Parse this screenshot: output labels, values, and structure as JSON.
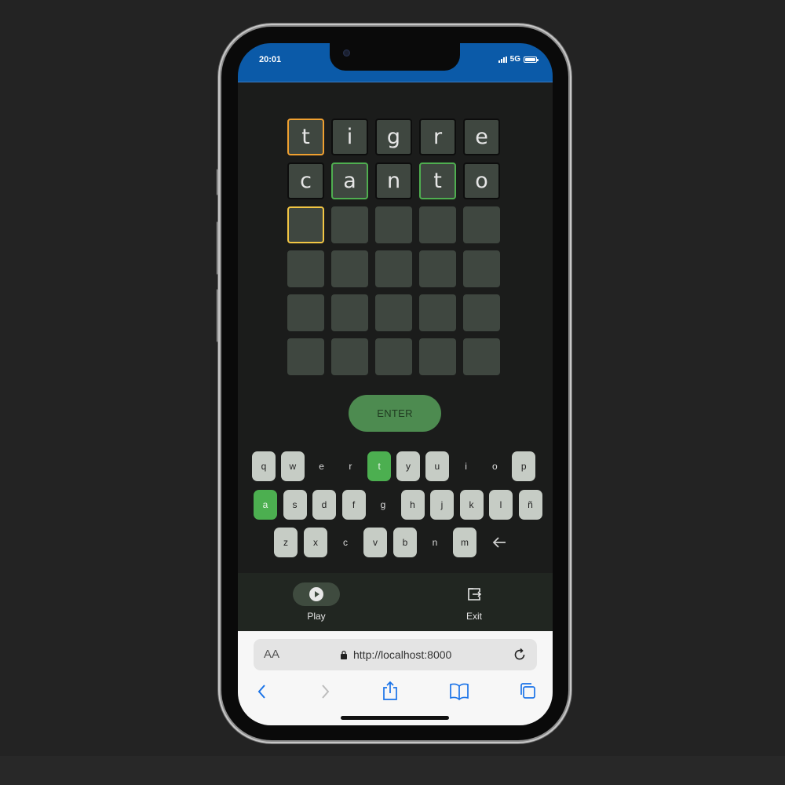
{
  "status": {
    "time": "20:01",
    "network": "5G"
  },
  "board": {
    "rows": [
      [
        {
          "letter": "t",
          "state": "present"
        },
        {
          "letter": "i",
          "state": "filled"
        },
        {
          "letter": "g",
          "state": "filled"
        },
        {
          "letter": "r",
          "state": "filled"
        },
        {
          "letter": "e",
          "state": "filled"
        }
      ],
      [
        {
          "letter": "c",
          "state": "filled"
        },
        {
          "letter": "a",
          "state": "correct"
        },
        {
          "letter": "n",
          "state": "filled"
        },
        {
          "letter": "t",
          "state": "correct"
        },
        {
          "letter": "o",
          "state": "filled"
        }
      ],
      [
        {
          "letter": "",
          "state": "cursor"
        },
        {
          "letter": "",
          "state": "empty"
        },
        {
          "letter": "",
          "state": "empty"
        },
        {
          "letter": "",
          "state": "empty"
        },
        {
          "letter": "",
          "state": "empty"
        }
      ],
      [
        {
          "letter": "",
          "state": "empty"
        },
        {
          "letter": "",
          "state": "empty"
        },
        {
          "letter": "",
          "state": "empty"
        },
        {
          "letter": "",
          "state": "empty"
        },
        {
          "letter": "",
          "state": "empty"
        }
      ],
      [
        {
          "letter": "",
          "state": "empty"
        },
        {
          "letter": "",
          "state": "empty"
        },
        {
          "letter": "",
          "state": "empty"
        },
        {
          "letter": "",
          "state": "empty"
        },
        {
          "letter": "",
          "state": "empty"
        }
      ],
      [
        {
          "letter": "",
          "state": "empty"
        },
        {
          "letter": "",
          "state": "empty"
        },
        {
          "letter": "",
          "state": "empty"
        },
        {
          "letter": "",
          "state": "empty"
        },
        {
          "letter": "",
          "state": "empty"
        }
      ]
    ],
    "enter_label": "ENTER"
  },
  "keyboard": {
    "rows": [
      [
        {
          "key": "q",
          "state": "normal"
        },
        {
          "key": "w",
          "state": "normal"
        },
        {
          "key": "e",
          "state": "used"
        },
        {
          "key": "r",
          "state": "used"
        },
        {
          "key": "t",
          "state": "hit"
        },
        {
          "key": "y",
          "state": "normal"
        },
        {
          "key": "u",
          "state": "normal"
        },
        {
          "key": "i",
          "state": "used"
        },
        {
          "key": "o",
          "state": "used"
        },
        {
          "key": "p",
          "state": "normal"
        }
      ],
      [
        {
          "key": "a",
          "state": "hit"
        },
        {
          "key": "s",
          "state": "normal"
        },
        {
          "key": "d",
          "state": "normal"
        },
        {
          "key": "f",
          "state": "normal"
        },
        {
          "key": "g",
          "state": "used"
        },
        {
          "key": "h",
          "state": "normal"
        },
        {
          "key": "j",
          "state": "normal"
        },
        {
          "key": "k",
          "state": "normal"
        },
        {
          "key": "l",
          "state": "normal"
        },
        {
          "key": "ñ",
          "state": "normal"
        }
      ],
      [
        {
          "key": "z",
          "state": "normal"
        },
        {
          "key": "x",
          "state": "normal"
        },
        {
          "key": "c",
          "state": "used"
        },
        {
          "key": "v",
          "state": "normal"
        },
        {
          "key": "b",
          "state": "normal"
        },
        {
          "key": "n",
          "state": "used"
        },
        {
          "key": "m",
          "state": "normal"
        }
      ]
    ],
    "backspace_icon": "arrow-left-icon"
  },
  "nav": {
    "play_label": "Play",
    "exit_label": "Exit",
    "play_icon": "play-circle-icon",
    "exit_icon": "exit-icon"
  },
  "browser": {
    "text_size_label": "AA",
    "url": "http://localhost:8000"
  },
  "colors": {
    "status_bar": "#0b5aa8",
    "correct": "#4caf50",
    "present": "#f0a030",
    "cursor": "#f2c644",
    "enter_button": "#4d8b50"
  }
}
